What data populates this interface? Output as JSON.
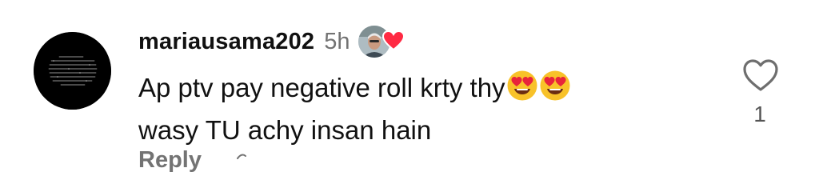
{
  "comment": {
    "username": "mariausama202",
    "time": "5h",
    "text_line1": "Ap ptv pay negative roll krty thy",
    "text_line2": "wasy TU achy insan hain",
    "reply_label": "Reply",
    "like_count": "1"
  },
  "icons": {
    "avatar": "avatar",
    "liked_by_creator": "creator-avatar-with-heart",
    "emoji_1": "heart-eyes-emoji",
    "emoji_2": "heart-eyes-emoji",
    "like": "heart-outline-icon"
  },
  "colors": {
    "text": "#111111",
    "muted": "#737373",
    "heart": "#ff2a43",
    "emoji_face": "#f8c229"
  }
}
